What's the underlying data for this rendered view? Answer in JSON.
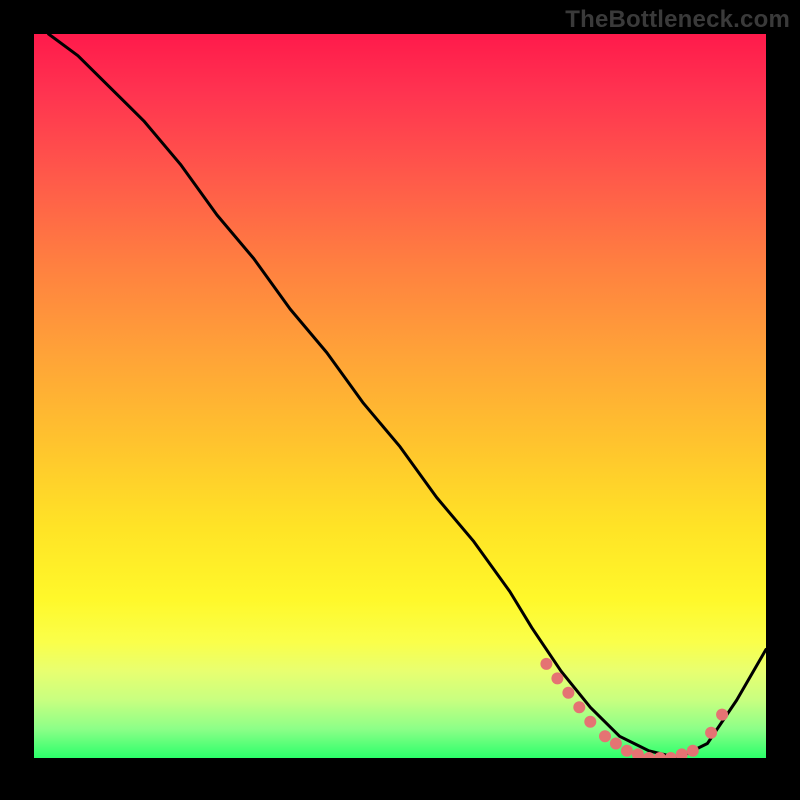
{
  "watermark": "TheBottleneck.com",
  "chart_data": {
    "type": "line",
    "title": "",
    "xlabel": "",
    "ylabel": "",
    "xlim": [
      0,
      100
    ],
    "ylim": [
      0,
      100
    ],
    "grid": false,
    "legend": false,
    "background": {
      "gradient": [
        "#ff1a4b",
        "#ffa238",
        "#fff82a",
        "#2bff6a"
      ],
      "direction": "top-to-bottom"
    },
    "series": [
      {
        "name": "bottleneck-curve",
        "color": "#000000",
        "x": [
          2,
          6,
          10,
          15,
          20,
          25,
          30,
          35,
          40,
          45,
          50,
          55,
          60,
          65,
          68,
          72,
          76,
          80,
          84,
          88,
          92,
          96,
          100
        ],
        "y": [
          100,
          97,
          93,
          88,
          82,
          75,
          69,
          62,
          56,
          49,
          43,
          36,
          30,
          23,
          18,
          12,
          7,
          3,
          1,
          0,
          2,
          8,
          15
        ]
      }
    ],
    "markers": [
      {
        "name": "highlight-dots",
        "color": "#e57373",
        "shape": "circle",
        "points_x": [
          70,
          71.5,
          73,
          74.5,
          76,
          78,
          79.5,
          81,
          82.5,
          84,
          85.5,
          87,
          88.5,
          90,
          92.5,
          94
        ],
        "points_y": [
          13,
          11,
          9,
          7,
          5,
          3,
          2,
          1,
          0.5,
          0,
          0,
          0,
          0.5,
          1,
          3.5,
          6
        ]
      }
    ]
  }
}
